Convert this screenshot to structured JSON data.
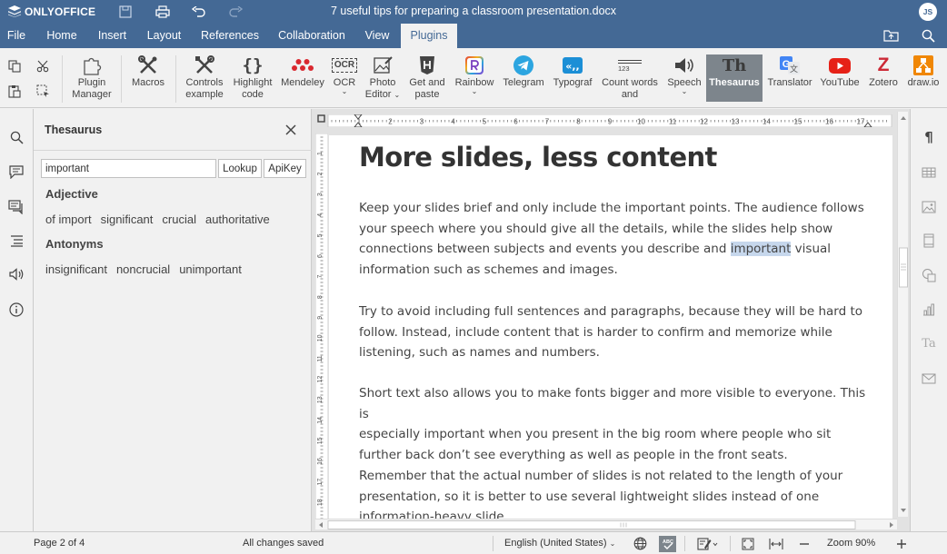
{
  "app": {
    "brand": "ONLYOFFICE",
    "doc_title": "7 useful tips for preparing a classroom presentation.docx",
    "user_initials": "JS"
  },
  "menu": {
    "tabs": [
      "File",
      "Home",
      "Insert",
      "Layout",
      "References",
      "Collaboration",
      "View",
      "Plugins"
    ],
    "active_tab": "Plugins"
  },
  "toolbar": {
    "plugin_manager": [
      "Plugin",
      "Manager"
    ],
    "macros": "Macros",
    "controls_example": [
      "Controls",
      "example"
    ],
    "highlight_code": [
      "Highlight",
      "code"
    ],
    "mendeley": "Mendeley",
    "ocr": "OCR",
    "ocr_icon_text": "OCR",
    "photo_editor": [
      "Photo",
      "Editor"
    ],
    "get_and_paste": [
      "Get and",
      "paste"
    ],
    "rainbow": "Rainbow",
    "telegram": "Telegram",
    "typograf": "Typograf",
    "count_words": [
      "Count words",
      "and"
    ],
    "count_words_icon_text": "123",
    "speech": "Speech",
    "thesaurus": "Thesaurus",
    "thesaurus_icon_text": "Th",
    "translator": "Translator",
    "youtube": "YouTube",
    "zotero": "Zotero",
    "zotero_icon_text": "Z",
    "drawio": "draw.io",
    "active_plugin": "Thesaurus"
  },
  "thesaurus": {
    "title": "Thesaurus",
    "search_value": "important",
    "lookup_label": "Lookup",
    "apikey_label": "ApiKey",
    "adjective_title": "Adjective",
    "adjectives": [
      "of import",
      "significant",
      "crucial",
      "authoritative"
    ],
    "antonyms_title": "Antonyms",
    "antonyms": [
      "insignificant",
      "noncrucial",
      "unimportant"
    ]
  },
  "document": {
    "heading": "More slides, less content",
    "p1": [
      "Keep your slides brief and only include the important points. The audience follows",
      "your speech where you should give all the details, while the slides help show",
      "connections between subjects and events you describe and ",
      "important",
      " visual",
      "information such as schemes and images."
    ],
    "p2": [
      "Try to avoid including full sentences and paragraphs, because they will be hard to",
      "follow. Instead, include content that is harder to confirm and memorize while",
      "listening, such as names and numbers."
    ],
    "p3": [
      "Short text also allows you to make fonts bigger and more visible to everyone. This is",
      "especially important when you present in the big room where people who sit",
      "further back don’t see everything as well as people in the front seats."
    ],
    "p4": [
      "Remember that the actual number of slides is not related to the length of your",
      "presentation, so it is better to use several lightweight slides instead of one",
      "information-heavy slide."
    ],
    "ruler_numbers": [
      "1",
      "2",
      "3",
      "4",
      "5",
      "6",
      "7",
      "8",
      "9",
      "10",
      "11",
      "12",
      "13",
      "14",
      "15",
      "16",
      "17"
    ],
    "vruler_numbers": [
      "1",
      "2",
      "3",
      "4",
      "5",
      "6",
      "7",
      "8",
      "9",
      "10",
      "11",
      "12",
      "13",
      "14",
      "15",
      "16",
      "17",
      "18"
    ]
  },
  "status": {
    "page": "Page 2 of 4",
    "saved": "All changes saved",
    "language": "English (United States)",
    "zoom": "Zoom 90%"
  },
  "colors": {
    "header": "#446995",
    "accent_active_plugin": "#7d858c",
    "highlight": "#c6d7ec"
  }
}
